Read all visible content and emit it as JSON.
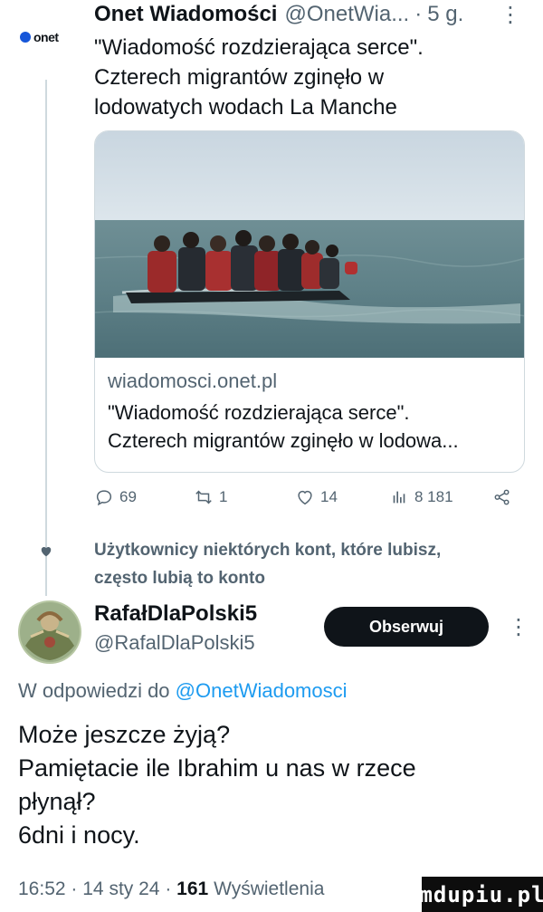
{
  "tweet": {
    "avatar_label": "onet",
    "author": "Onet Wiadomości",
    "handle": "@OnetWia...",
    "separator": "·",
    "time": "5 g.",
    "more": "⋮",
    "text_lines": [
      "\"Wiadomość rozdzierająca serce\".",
      "Czterech migrantów zginęło w",
      "lodowatych wodach La Manche"
    ],
    "card": {
      "domain": "wiadomosci.onet.pl",
      "title_lines": [
        "\"Wiadomość rozdzierająca serce\".",
        "Czterech migrantów zginęło w lodowa..."
      ]
    },
    "actions": {
      "replies": "69",
      "retweets": "1",
      "likes": "14",
      "views": "8 181"
    }
  },
  "suggestion": {
    "text_lines": [
      "Użytkownicy niektórych kont, które lubisz,",
      "często lubią to konto"
    ]
  },
  "reply": {
    "author": "RafałDlaPolski5",
    "handle": "@RafalDlaPolski5",
    "follow_label": "Obserwuj",
    "more": "⋮",
    "reply_prefix": "W odpowiedzi do",
    "reply_mention": "@OnetWiadomosci",
    "text_lines": [
      "Może jeszcze żyją?",
      "Pamiętacie ile Ibrahim u nas w rzece",
      "płynął?",
      "6dni i nocy."
    ],
    "time": "16:52",
    "date": "14 sty 24",
    "separator": "·",
    "views": "161",
    "views_label": "Wyświetlenia"
  },
  "watermark": "mdupiu.pl",
  "colors": {
    "text": "#0f1419",
    "secondary": "#536471",
    "link": "#1d9bf0",
    "border": "#cfd9de",
    "onet_blue": "#1656d9"
  }
}
